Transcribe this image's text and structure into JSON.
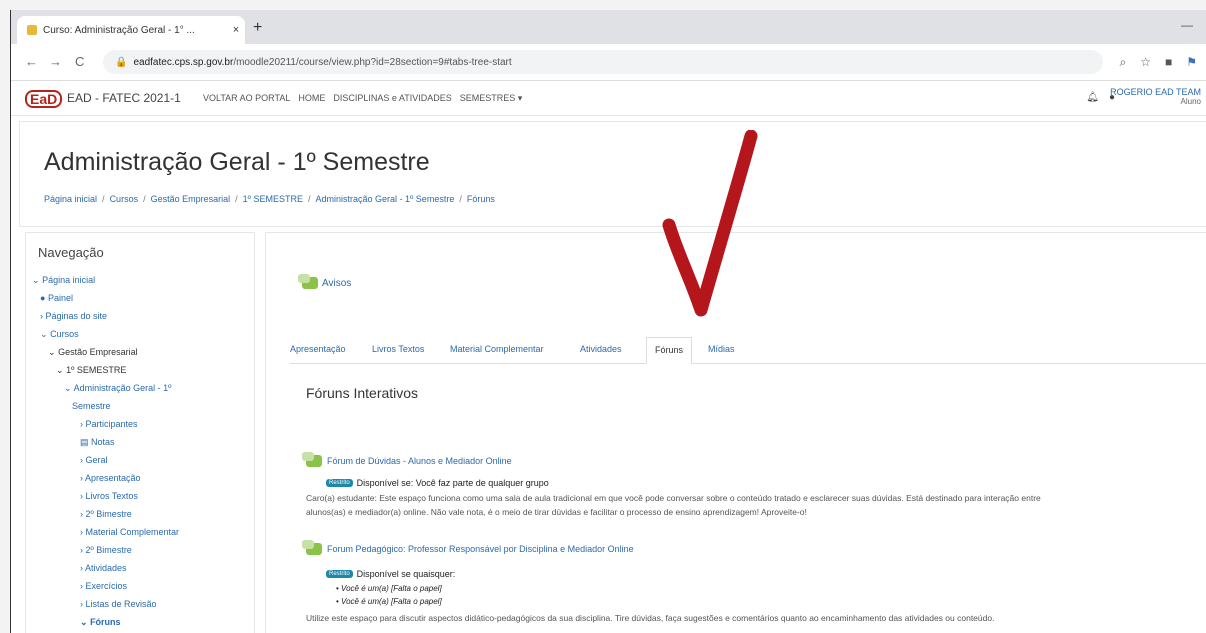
{
  "browser": {
    "tab_title": "Curso: Administração Geral - 1° ...",
    "close": "×",
    "new_tab": "+",
    "minimize": "—",
    "back": "←",
    "forward": "→",
    "reload": "C",
    "url_host": "eadfatec.cps.sp.gov.br",
    "url_path": "/moodle20211/course/view.php?id=28section=9#tabs-tree-start"
  },
  "site": {
    "logo": "EaD",
    "name": "EAD - FATEC 2021-1",
    "menu": [
      "VOLTAR AO PORTAL",
      "HOME",
      "DISCIPLINAS e ATIVIDADES",
      "SEMESTRES ▾"
    ],
    "user": "ROGERIO EAD TEAM",
    "role": "Aluno"
  },
  "page": {
    "title": "Administração Geral - 1º Semestre",
    "breadcrumb": [
      "Página inicial",
      "Cursos",
      "Gestão Empresarial",
      "1º SEMESTRE",
      "Administração Geral - 1º Semestre",
      "Fóruns"
    ]
  },
  "nav": {
    "title": "Navegação",
    "items": [
      {
        "label": "Página inicial",
        "prefix": "⌄"
      },
      {
        "label": "Painel",
        "prefix": "●"
      },
      {
        "label": "Páginas do site",
        "prefix": "›"
      },
      {
        "label": "Cursos",
        "prefix": "⌄"
      },
      {
        "label": "Gestão Empresarial",
        "prefix": "⌄"
      },
      {
        "label": "1º SEMESTRE",
        "prefix": "⌄"
      },
      {
        "label": "Administração Geral - 1º",
        "prefix": "⌄"
      },
      {
        "label": "Semestre",
        "prefix": ""
      },
      {
        "label": "Participantes",
        "prefix": "›"
      },
      {
        "label": "Notas",
        "prefix": "▤"
      },
      {
        "label": "Geral",
        "prefix": "›"
      },
      {
        "label": "Apresentação",
        "prefix": "›"
      },
      {
        "label": "Livros Textos",
        "prefix": "›"
      },
      {
        "label": "2º Bimestre",
        "prefix": "›"
      },
      {
        "label": "Material Complementar",
        "prefix": "›"
      },
      {
        "label": "2º Bimestre",
        "prefix": "›"
      },
      {
        "label": "Atividades",
        "prefix": "›"
      },
      {
        "label": "Exercícios",
        "prefix": "›"
      },
      {
        "label": "Listas de Revisão",
        "prefix": "›"
      },
      {
        "label": "Fóruns",
        "prefix": "⌄"
      }
    ]
  },
  "main": {
    "avisos": "Avisos",
    "tabs": [
      "Apresentação",
      "Livros Textos",
      "Material Complementar",
      "Atividades",
      "Fóruns",
      "Mídias"
    ],
    "section_title": "Fóruns Interativos",
    "forum1": {
      "title": "Fórum de Dúvidas - Alunos e Mediador Online",
      "badge": "Restrito",
      "restriction": "Disponível se: Você faz parte de qualquer grupo",
      "desc1": "Caro(a) estudante: Este espaço funciona como uma sala de aula tradicional em que você pode conversar sobre o conteúdo tratado e esclarecer suas dúvidas. Está destinado para interação entre",
      "desc2": "alunos(as) e mediador(a) online. Não vale nota, é o meio de tirar dúvidas e facilitar o processo de ensino aprendizagem! Aproveite-o!"
    },
    "forum2": {
      "title": "Forum Pedagógico: Professor Responsável por Disciplina e Mediador Online",
      "badge": "Restrito",
      "restriction": "Disponível se quaisquer:",
      "items": [
        "Você é um(a) [Falta o papel]",
        "Você é um(a) [Falta o papel]"
      ],
      "desc": "Utilize este espaço para discutir aspectos didático-pedagógicos da sua disciplina. Tire dúvidas, faça sugestões e comentários quanto ao encaminhamento das atividades ou conteúdo."
    }
  },
  "colors": {
    "arrow": "#b5161b",
    "link": "#2a6aad",
    "logo": "#b5241b"
  }
}
